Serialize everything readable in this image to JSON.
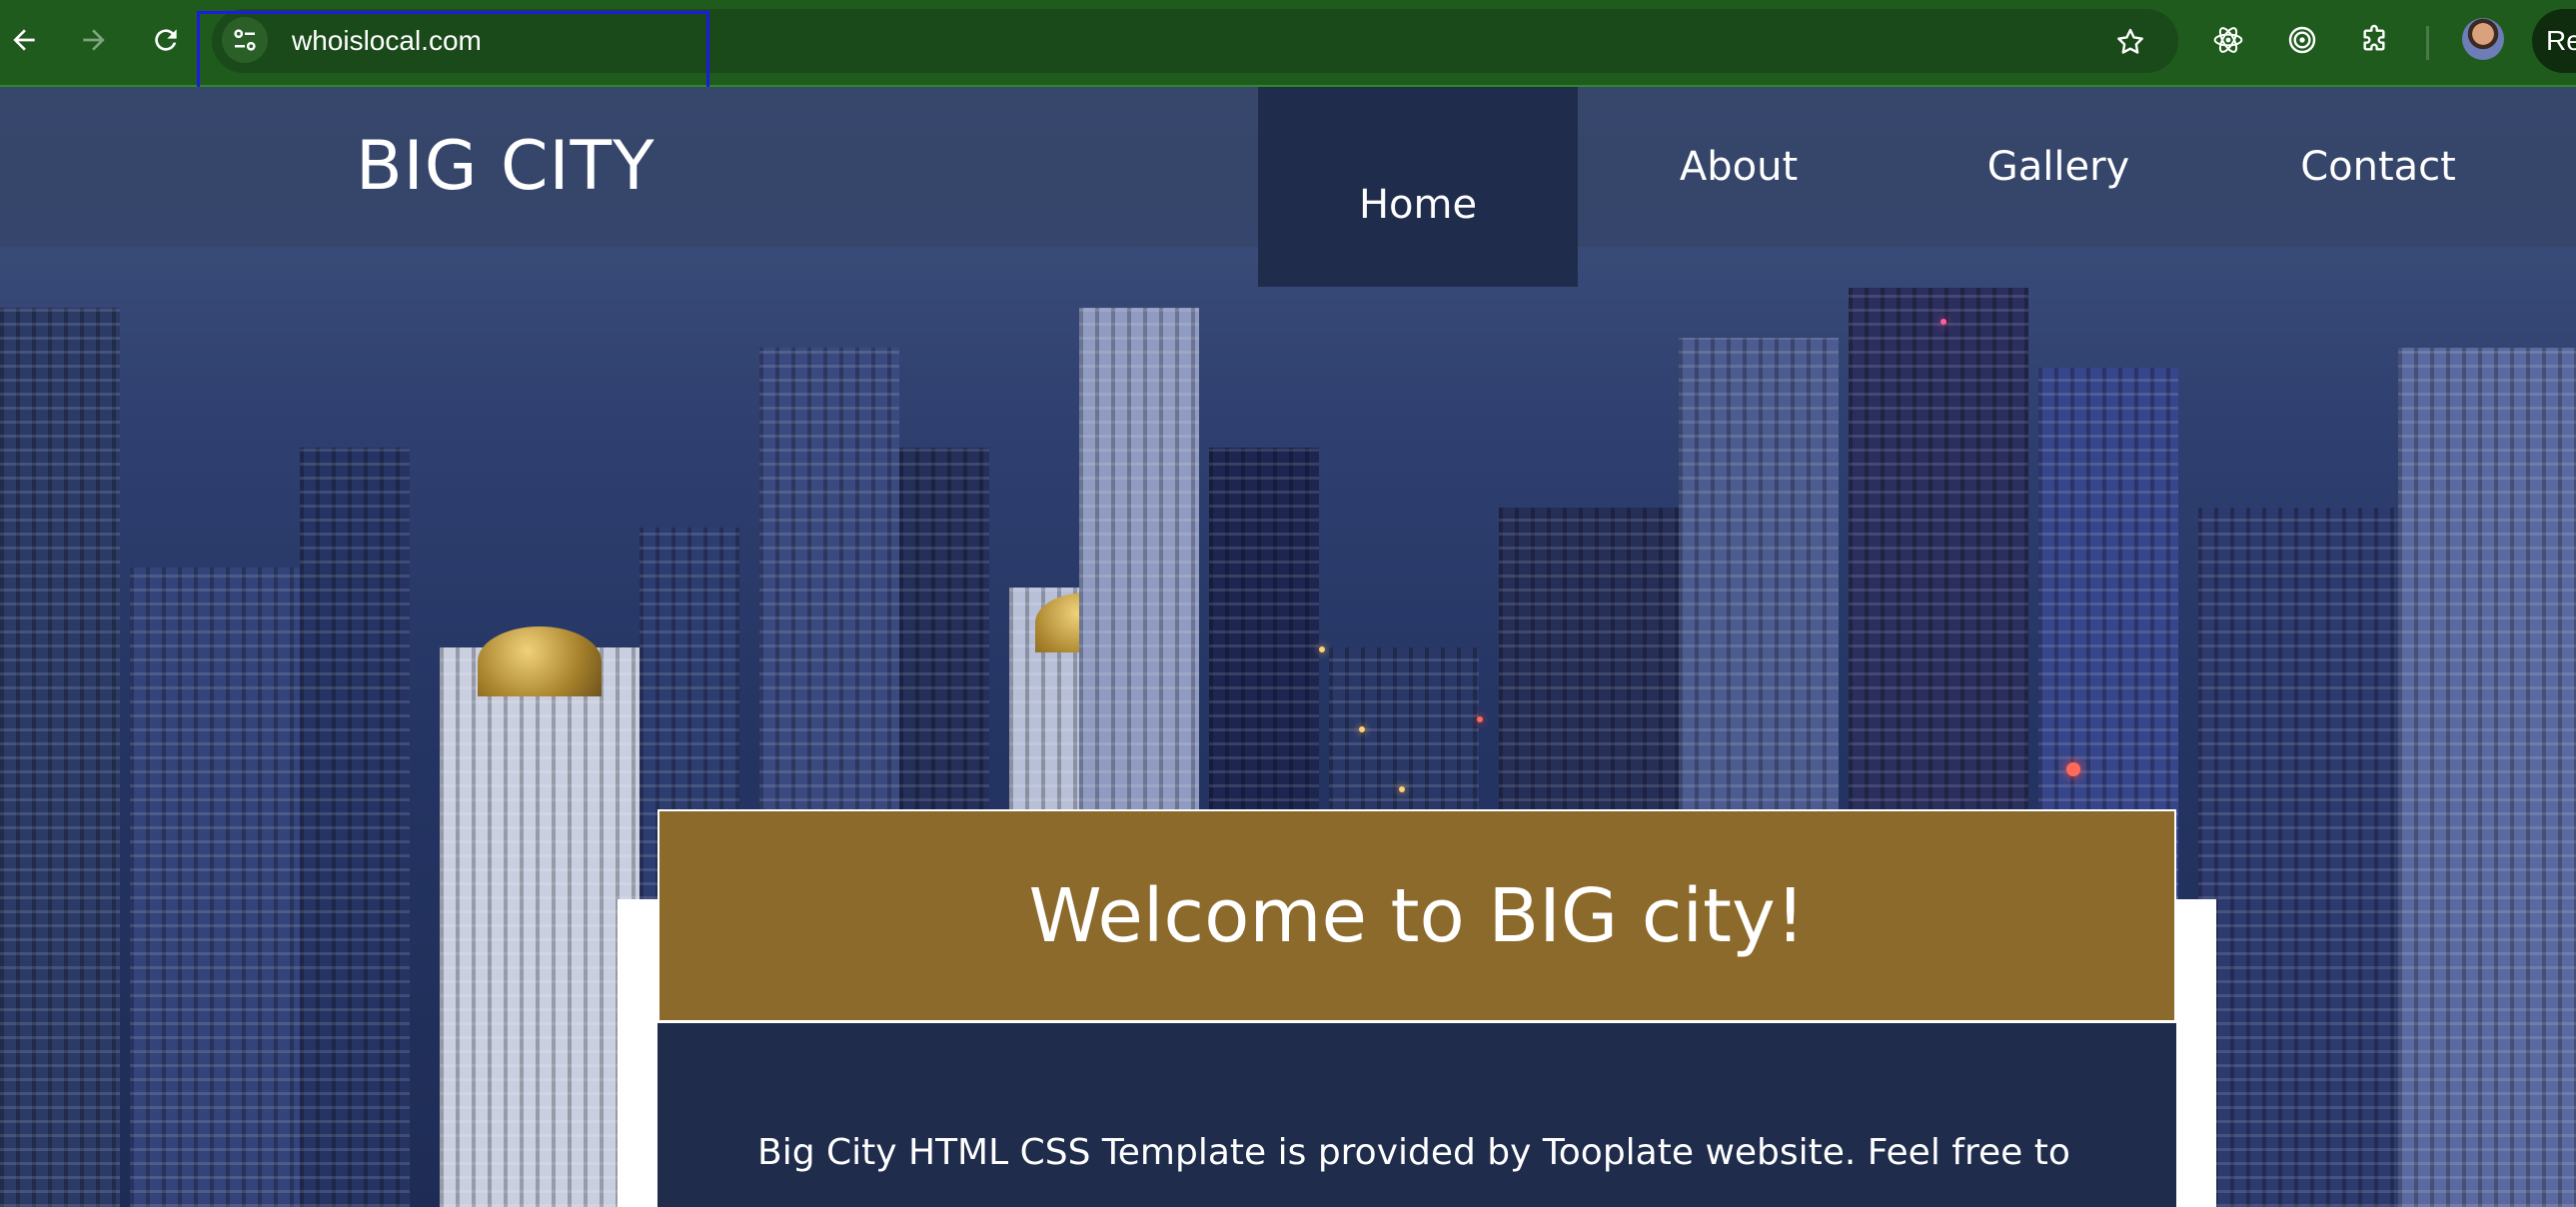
{
  "browser": {
    "url": "whoislocal.com",
    "relaunch_label": "Re",
    "icons": {
      "back": "back-arrow-icon",
      "forward": "forward-arrow-icon",
      "reload": "reload-icon",
      "site_info": "tune-icon",
      "bookmark": "star-icon",
      "ext1": "react-icon",
      "ext2": "target-icon",
      "ext3": "puzzle-icon",
      "profile": "avatar"
    },
    "colors": {
      "frame": "#1f5b1d",
      "omnibox": "#1a4a19",
      "highlight": "#1c1ce0"
    }
  },
  "site": {
    "brand": "BIG CITY",
    "nav": [
      {
        "label": "Home",
        "active": true
      },
      {
        "label": "About",
        "active": false
      },
      {
        "label": "Gallery",
        "active": false
      },
      {
        "label": "Contact",
        "active": false
      }
    ],
    "welcome": {
      "title": "Welcome to BIG city!",
      "text": "Big City HTML CSS Template is provided by Tooplate website. Feel free to"
    },
    "colors": {
      "navbar": "#344468",
      "nav_active": "#1f2c4c",
      "welcome_head": "#8b6a2b",
      "welcome_body": "#1f2c4c"
    }
  }
}
